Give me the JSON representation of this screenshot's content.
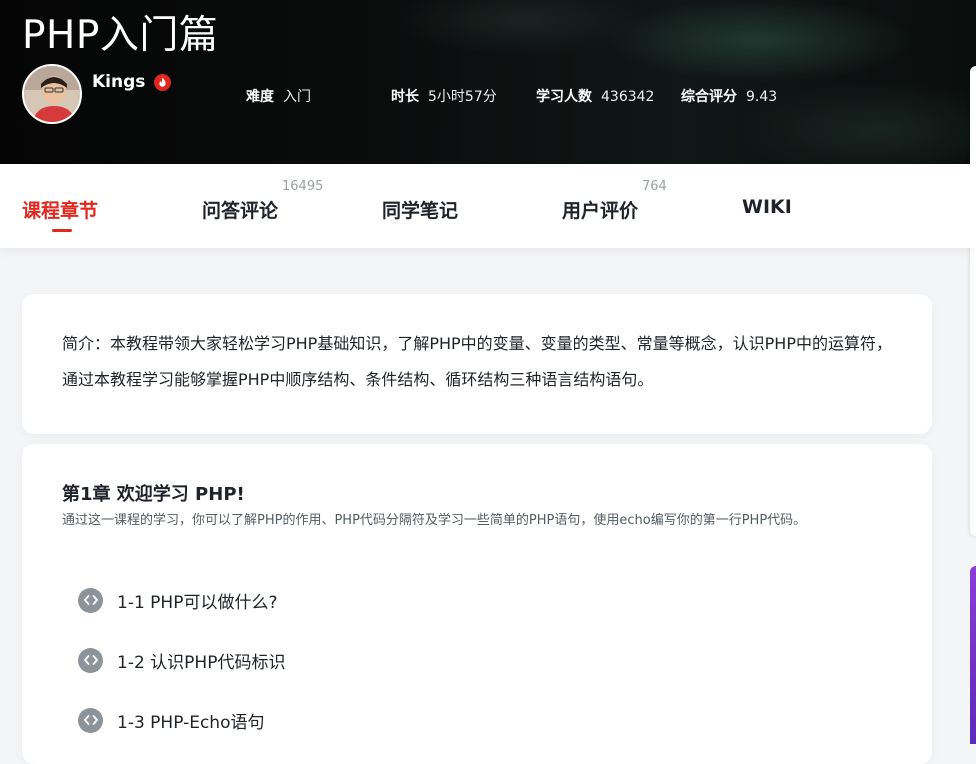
{
  "header": {
    "course_title": "PHP入门篇",
    "author": {
      "name": "Kings",
      "badge_icon": "flame-badge-icon"
    },
    "stats": [
      {
        "key": "难度",
        "value": "入门"
      },
      {
        "key": "时长",
        "value": "5小时57分"
      },
      {
        "key": "学习人数",
        "value": "436342"
      },
      {
        "key": "综合评分",
        "value": "9.43"
      }
    ]
  },
  "tabs": [
    {
      "label": "课程章节",
      "active": true
    },
    {
      "label": "问答评论",
      "count": "16495"
    },
    {
      "label": "同学笔记"
    },
    {
      "label": "用户评价",
      "count": "764"
    },
    {
      "label": "WIKI"
    }
  ],
  "intro": {
    "text": "简介：本教程带领大家轻松学习PHP基础知识，了解PHP中的变量、变量的类型、常量等概念，认识PHP中的运算符，通过本教程学习能够掌握PHP中顺序结构、条件结构、循环结构三种语言结构语句。"
  },
  "chapter": {
    "title": "第1章 欢迎学习 PHP!",
    "description": "通过这一课程的学习，你可以了解PHP的作用、PHP代码分隔符及学习一些简单的PHP语句，使用echo编写你的第一行PHP代码。",
    "lessons": [
      {
        "label": "1-1 PHP可以做什么?",
        "icon": "code-brackets-icon"
      },
      {
        "label": "1-2 认识PHP代码标识",
        "icon": "code-brackets-icon"
      },
      {
        "label": "1-3 PHP-Echo语句",
        "icon": "code-brackets-icon"
      }
    ]
  },
  "colors": {
    "accent": "#e0281e",
    "icon_gray": "#8c939a",
    "banner_bg": "#0b0d0d"
  }
}
